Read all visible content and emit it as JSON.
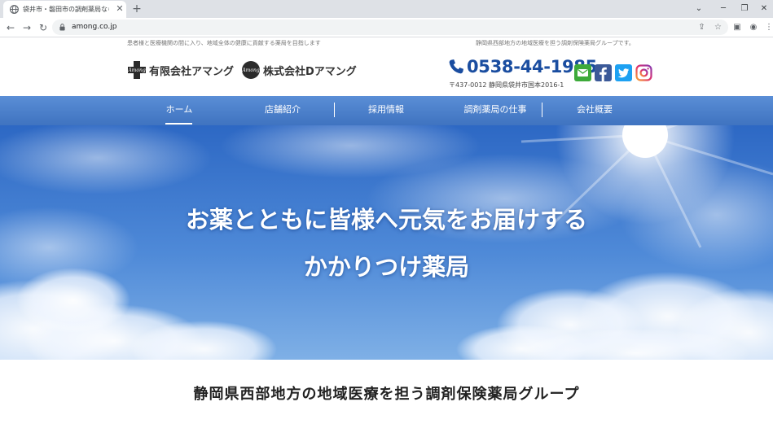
{
  "browser": {
    "tab_title": "袋井市・磐田市の調剤薬局なら",
    "tab_close_glyph": "✕",
    "new_tab_glyph": "+",
    "back_glyph": "←",
    "forward_glyph": "→",
    "reload_glyph": "↻",
    "url": "among.co.jp",
    "icons": [
      "globe-icon",
      "lock-icon",
      "share-icon",
      "star-icon",
      "sidepanel-icon",
      "profile-icon",
      "menu-icon"
    ]
  },
  "header": {
    "tagline_left": "患者様と医療機関の間に入り、地域全体の健康に貢献する薬局を目指します",
    "tagline_right": "静岡県西部地方の地域医療を担う調剤保険薬局グループです。",
    "logos": [
      {
        "label": "有限会社アマング",
        "mark_text": "Among"
      },
      {
        "label": "株式会社Dアマング",
        "mark_text": "Among"
      }
    ],
    "phone": "0538-44-1985",
    "address": "〒437-0012  静岡県袋井市国本2016-1",
    "social": [
      "mail-icon",
      "facebook-icon",
      "twitter-icon",
      "instagram-icon"
    ]
  },
  "nav": {
    "items": [
      "ホーム",
      "店舗紹介",
      "採用情報",
      "調剤薬局の仕事",
      "会社概要"
    ],
    "active_index": 0
  },
  "hero": {
    "line1": "お薬とともに皆様へ元気をお届けする",
    "line2": "かかりつけ薬局"
  },
  "lead": "静岡県西部地方の地域医療を担う調剤保険薬局グループ",
  "colors": {
    "brand_blue": "#1a4da0",
    "nav_blue": "#4a7fcb",
    "mail_green": "#3daa3a",
    "facebook_blue": "#3b5998",
    "twitter_blue": "#1da1f2"
  }
}
